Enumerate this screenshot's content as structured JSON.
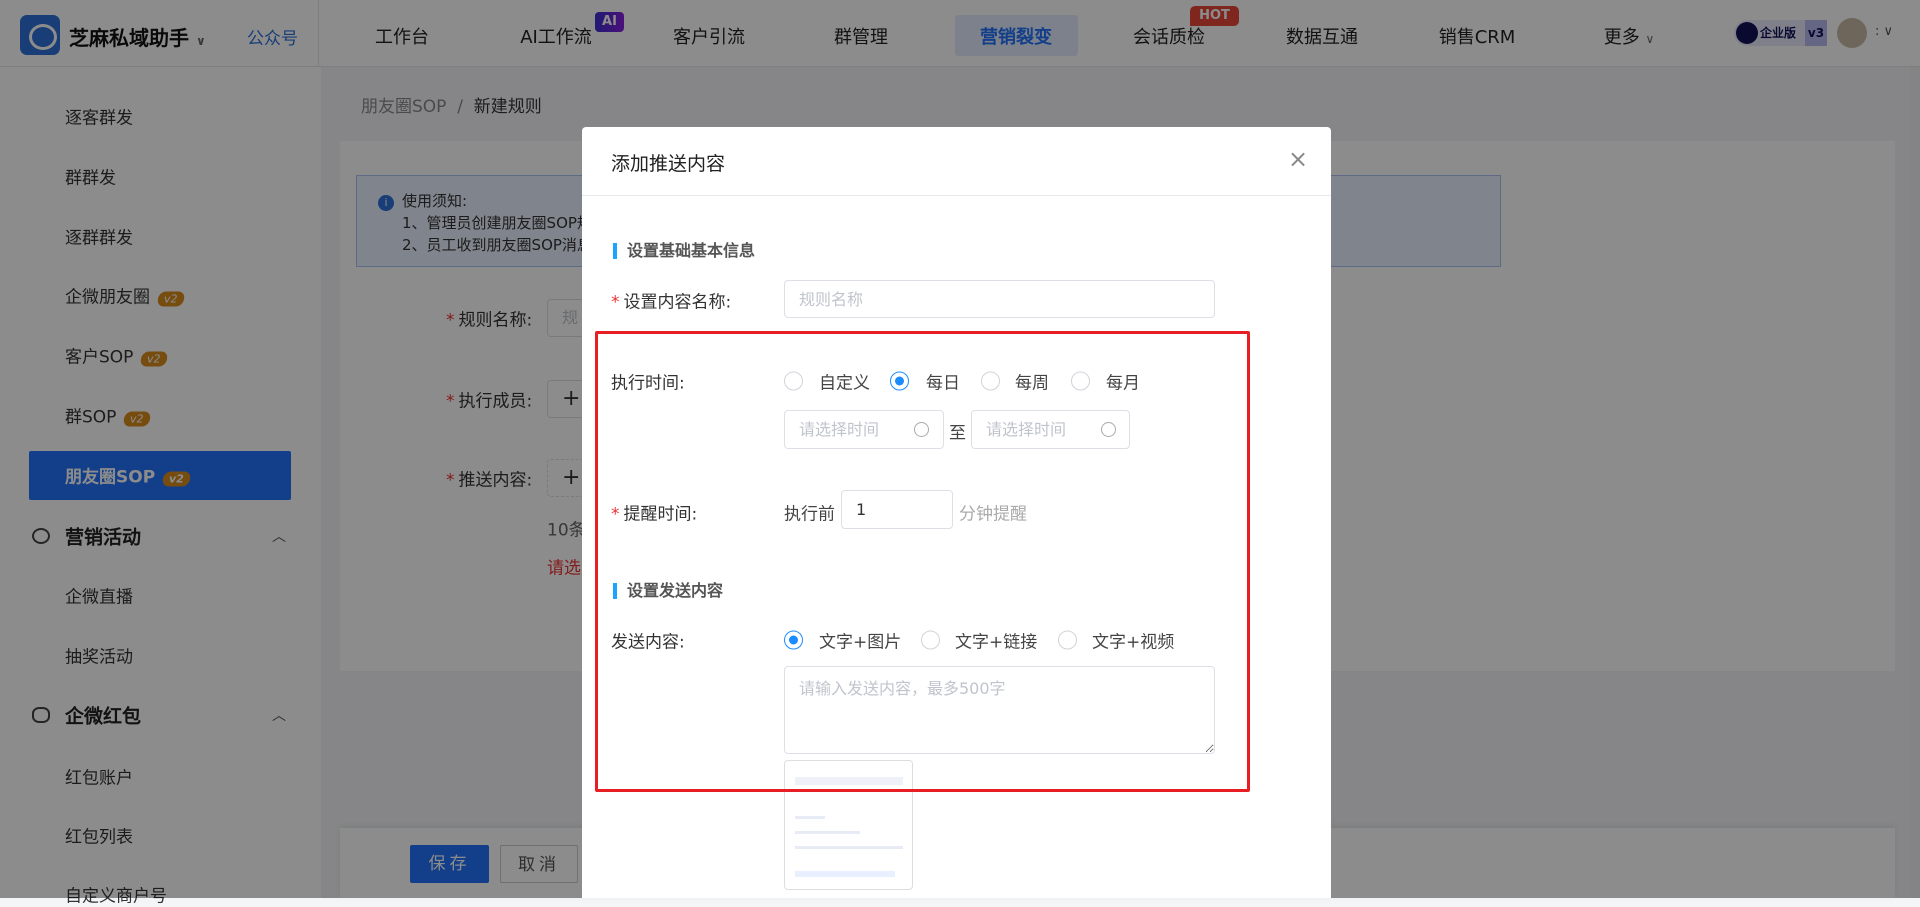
{
  "header": {
    "brand": "芝麻私域助手",
    "account": "公众号",
    "nav": [
      "工作台",
      "AI工作流",
      "客户引流",
      "群管理",
      "营销裂变",
      "会话质检",
      "数据互通",
      "销售CRM",
      "更多"
    ],
    "active_nav": "营销裂变",
    "ai_badge": "AI",
    "hot_badge": "HOT",
    "edition": "企业版",
    "edition_version": "v3"
  },
  "sidebar": {
    "items": [
      "逐客群发",
      "群群发",
      "逐群群发",
      "企微朋友圈",
      "客户SOP",
      "群SOP",
      "朋友圈SOP"
    ],
    "badge": "v2",
    "active": "朋友圈SOP",
    "groups": [
      {
        "label": "营销活动",
        "items": [
          "企微直播",
          "抽奖活动"
        ]
      },
      {
        "label": "企微红包",
        "items": [
          "红包账户",
          "红包列表",
          "自定义商户号"
        ]
      }
    ]
  },
  "breadcrumb": {
    "parent": "朋友圈SOP",
    "sep": "/",
    "current": "新建规则"
  },
  "notice": {
    "title": "使用须知:",
    "lines": [
      "1、管理员创建朋友圈SOP规",
      "2、员工收到朋友圈SOP消息"
    ]
  },
  "form": {
    "rule_name": "规则名称:",
    "rule_placeholder": "规",
    "members": "执行成员:",
    "push": "推送内容:",
    "plus": "+",
    "count_hint": "10条",
    "error_hint": "请选"
  },
  "footer": {
    "save": "保存",
    "cancel": "取消"
  },
  "modal": {
    "title": "添加推送内容",
    "close": "×",
    "section1": "设置基础基本信息",
    "name_label": "设置内容名称:",
    "name_placeholder": "规则名称",
    "exec_label": "执行时间:",
    "exec_options": [
      "自定义",
      "每日",
      "每周",
      "每月"
    ],
    "exec_selected": "每日",
    "time_placeholder": "请选择时间",
    "to": "至",
    "remind_label": "提醒时间:",
    "remind_prefix": "执行前",
    "remind_value": "1",
    "remind_suffix": "分钟提醒",
    "section2": "设置发送内容",
    "send_label": "发送内容:",
    "send_options": [
      "文字+图片",
      "文字+链接",
      "文字+视频"
    ],
    "send_selected": "文字+图片",
    "content_placeholder": "请输入发送内容，最多500字"
  },
  "colors": {
    "primary": "#2373fb",
    "highlight": "#e81e25",
    "radio": "#1a8cff"
  }
}
